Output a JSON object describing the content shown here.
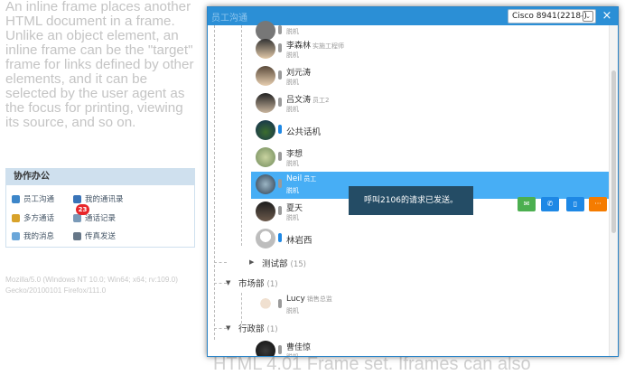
{
  "background": {
    "intro_text": "An inline frame places another HTML document in a frame. Unlike an object element, an inline frame can be the \"target\" frame for links defined by other elements, and it can be selected by the user agent as the focus for printing, viewing its source, and so on.",
    "user_agent": "Mozilla/5.0 (Windows NT 10.0; Win64; x64; rv:109.0) Gecko/20100101 Firefox/111.0",
    "bottom_text": "HTML 4.01 Frame set. Iframes can also"
  },
  "panel": {
    "title": "协作办公",
    "items": [
      {
        "label": "员工沟通",
        "icon": "people-icon",
        "color": "#3d86c9"
      },
      {
        "label": "我的通讯录",
        "icon": "address-book-icon",
        "color": "#3a74b8"
      },
      {
        "label": "多方通话",
        "icon": "group-call-icon",
        "color": "#d8a22a"
      },
      {
        "label": "通话记录",
        "icon": "call-log-icon",
        "color": "#7a9ab8"
      },
      {
        "label": "我的消息",
        "icon": "message-icon",
        "color": "#6aa6d9"
      },
      {
        "label": "传真发送",
        "icon": "fax-icon",
        "color": "#667788"
      }
    ],
    "badge_count": "23"
  },
  "window": {
    "title": "员工沟通",
    "device_select": "Cisco 8941(2218-)",
    "close_label": "×",
    "toast": "呼叫2106的请求已发送。",
    "contacts": [
      {
        "name": "",
        "role": "",
        "status": "脱机"
      },
      {
        "name": "李森林",
        "role": "实施工程师",
        "status": "脱机"
      },
      {
        "name": "刘元涛",
        "role": "",
        "status": "脱机"
      },
      {
        "name": "吕文涛",
        "role": "员工2",
        "status": "脱机"
      },
      {
        "name": "公共话机",
        "role": "",
        "status": ""
      },
      {
        "name": "李想",
        "role": "",
        "status": "脱机"
      },
      {
        "name": "Neil",
        "role": "员工",
        "status": "脱机"
      },
      {
        "name": "夏天",
        "role": "",
        "status": "脱机"
      },
      {
        "name": "林岩西",
        "role": "",
        "status": ""
      },
      {
        "name": "Lucy",
        "role": "销售总监",
        "status": "脱机"
      },
      {
        "name": "曹佳惊",
        "role": "",
        "status": "脱机"
      }
    ],
    "departments": [
      {
        "name": "测试部",
        "count": "(15)"
      },
      {
        "name": "市场部",
        "count": "(1)"
      },
      {
        "name": "行政部",
        "count": "(1)"
      }
    ],
    "actions": [
      {
        "icon": "chat-icon",
        "label": "✉",
        "color": "#4caf50"
      },
      {
        "icon": "phone-icon",
        "label": "✆",
        "color": "#1e88e5"
      },
      {
        "icon": "mobile-icon",
        "label": "▯",
        "color": "#1e88e5"
      },
      {
        "icon": "more-icon",
        "label": "···",
        "color": "#f57c00"
      }
    ]
  }
}
